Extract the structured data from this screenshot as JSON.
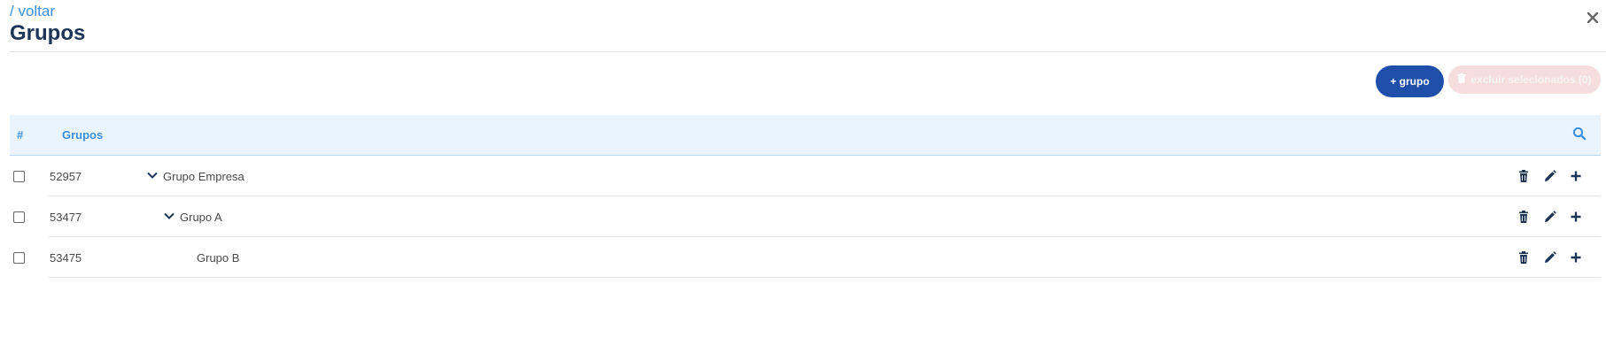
{
  "header": {
    "back_link": "/ voltar",
    "title": "Grupos"
  },
  "toolbar": {
    "add_label": "+ grupo",
    "delete_label": "excluir selecionados (0)"
  },
  "table": {
    "columns": [
      "#",
      "Grupos"
    ],
    "rows": [
      {
        "id": "52957",
        "name": "Grupo Empresa",
        "expanded": true,
        "level": 0
      },
      {
        "id": "53477",
        "name": "Grupo A",
        "expanded": true,
        "level": 1
      },
      {
        "id": "53475",
        "name": "Grupo B",
        "expanded": false,
        "level": 2
      }
    ]
  },
  "colors": {
    "accent": "#3a8fe0",
    "primary_button": "#1f4fa8",
    "title": "#1d3557",
    "disabled_button": "#f7dede",
    "header_bg": "#eaf4fd"
  },
  "icons": [
    "close-icon",
    "search-icon",
    "chevron-down-icon",
    "trash-icon",
    "pencil-icon",
    "plus-icon"
  ]
}
